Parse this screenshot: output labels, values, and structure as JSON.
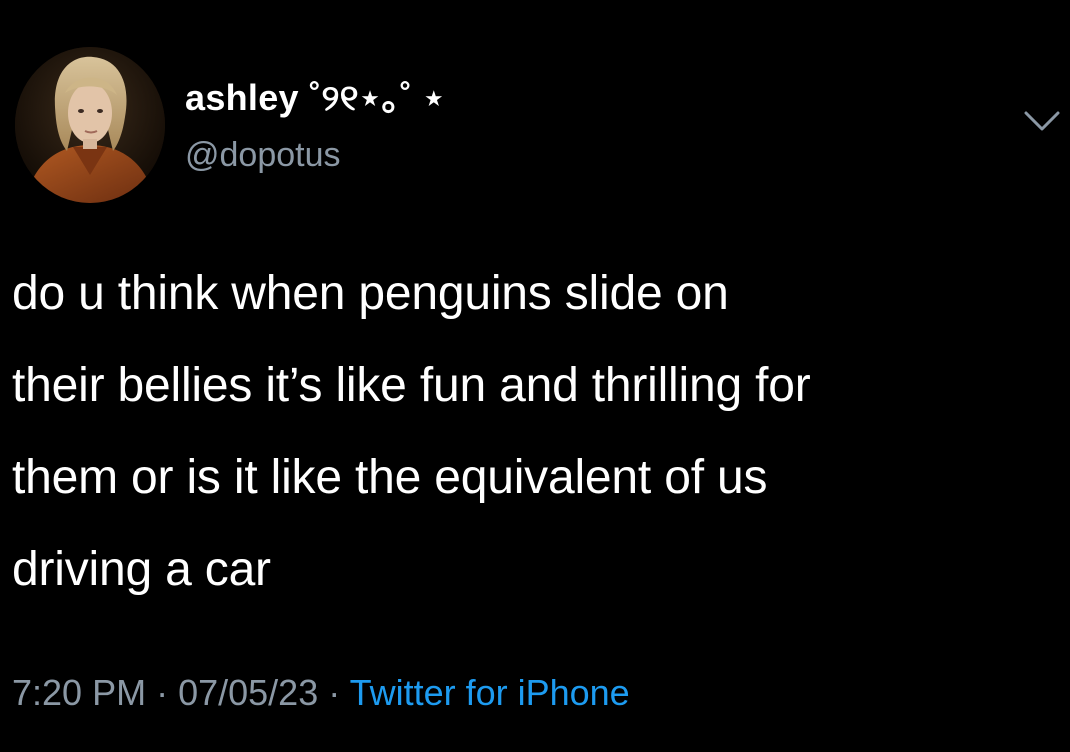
{
  "user": {
    "display_name": "ashley ˚୨୧⋆｡˚ ⋆",
    "handle": "@dopotus"
  },
  "tweet": {
    "text": "do u think when penguins slide on\ntheir bellies it’s like fun and thrilling for\nthem or is it like the equivalent of us\ndriving a car",
    "time": "7:20 PM",
    "separator": " · ",
    "date": "07/05/23",
    "source": "Twitter for iPhone"
  },
  "icons": {
    "avatar": "avatar-image",
    "more": "chevron-down-icon"
  },
  "colors": {
    "background": "#000000",
    "text": "#ffffff",
    "secondary": "#8b98a5",
    "link": "#1d9bf0"
  }
}
